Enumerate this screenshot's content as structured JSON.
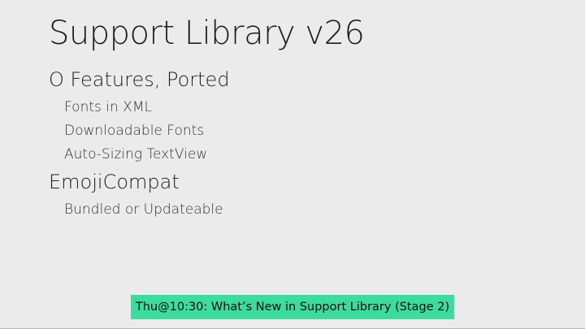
{
  "slide": {
    "title": "Support Library v26",
    "sections": [
      {
        "heading": "O Features, Ported",
        "items": [
          "Fonts in XML",
          "Downloadable Fonts",
          "Auto-Sizing TextView"
        ]
      },
      {
        "heading": "EmojiCompat",
        "items": [
          "Bundled or Updateable"
        ]
      }
    ]
  },
  "banner": {
    "text": "Thu@10:30: What’s New in Support Library (Stage 2)"
  },
  "colors": {
    "background": "#ebebeb",
    "banner": "#3ddc9e"
  }
}
